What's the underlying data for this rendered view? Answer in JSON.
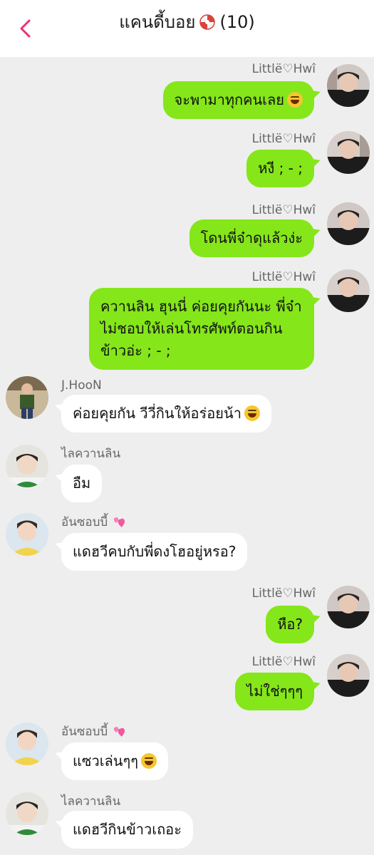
{
  "header": {
    "title": "แคนดี้บอย",
    "count": "(10)"
  },
  "messages": [
    {
      "sender": "Littlë♡Hwî",
      "text": "จะพามาทุกคนเลย",
      "emoji": "grinning-squint"
    },
    {
      "sender": "Littlë♡Hwî",
      "text": "หงี ; - ;"
    },
    {
      "sender": "Littlë♡Hwî",
      "text": "โดนพี่จ๋าดุแล้วง่ะ"
    },
    {
      "sender": "Littlë♡Hwî",
      "lines": [
        "ควานลิน ฮุนนี่ ค่อยคุยกันนะ พี่จ๋า",
        "ไม่ชอบให้เล่นโทรศัพท์ตอนกิน",
        "ข้าวอ่ะ ; - ;"
      ]
    },
    {
      "sender": "J.HooN",
      "text": "ค่อยคุยกัน วีวี่กินให้อร่อยน้า",
      "emoji": "grinning-squint"
    },
    {
      "sender": "ไลควานลิน",
      "text": "อืม"
    },
    {
      "sender": "อันซอบบี้",
      "text": "แดฮวีคบกับพี่ดงโฮอยู่หรอ?"
    },
    {
      "sender": "Littlë♡Hwî",
      "text": "หือ?"
    },
    {
      "sender": "Littlë♡Hwî",
      "text": "ไม่ใช่ๆๆๆ"
    },
    {
      "sender": "อันซอบบี้",
      "text": "แซวเล่นๆๆ",
      "emoji": "rolling-laughing"
    },
    {
      "sender": "ไลควานลิน",
      "text": "แดฮวีกินข้าวเถอะ"
    }
  ],
  "colors": {
    "outgoing_bubble": "#85e61a",
    "incoming_bubble": "#ffffff",
    "accent": "#e83e8c"
  }
}
